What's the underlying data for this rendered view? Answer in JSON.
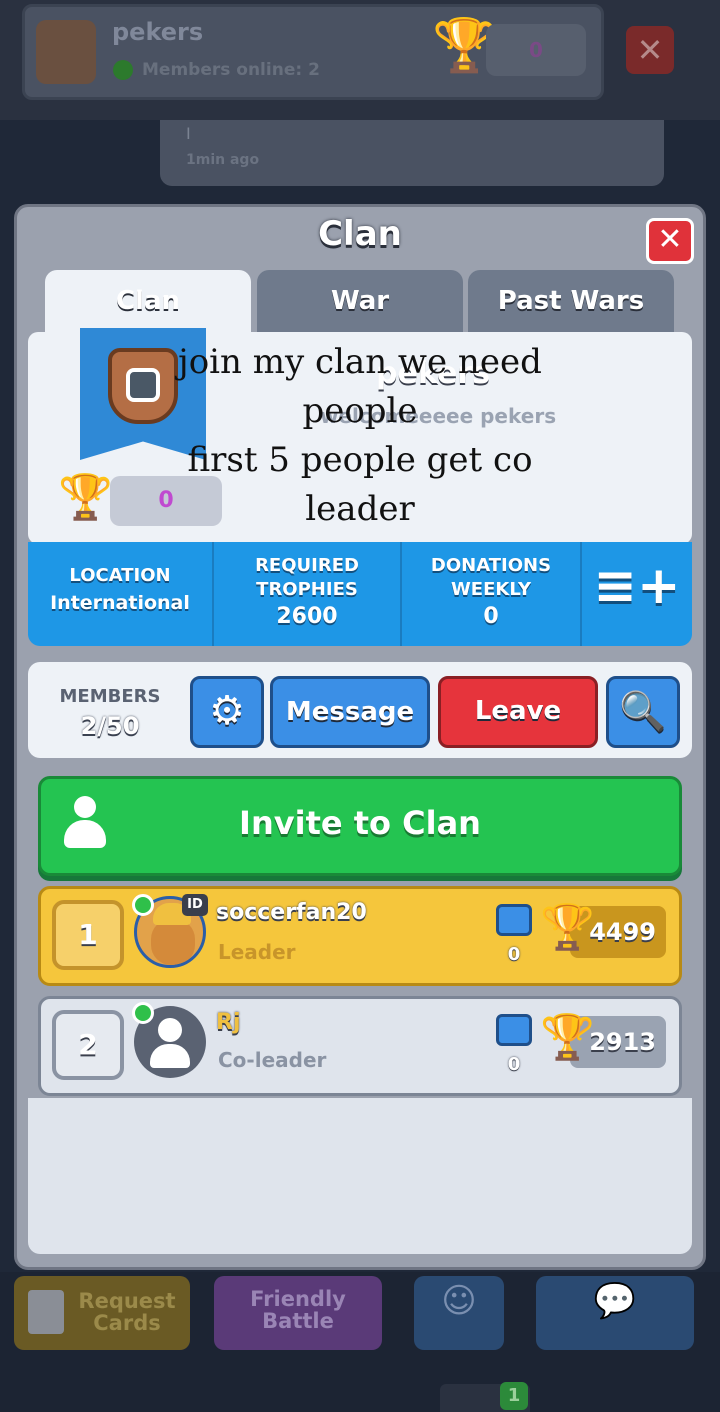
{
  "background": {
    "clan_name": "pekers",
    "members_online": "Members online: 2",
    "trophy_count": "0",
    "chat_message": "I",
    "chat_time": "1min ago"
  },
  "modal": {
    "title": "Clan",
    "close_label": "✕",
    "tabs": [
      {
        "label": "Clan",
        "active": true
      },
      {
        "label": "War",
        "active": false
      },
      {
        "label": "Past Wars",
        "active": false
      }
    ],
    "overlay_text": [
      "join my clan we need",
      "people",
      "first 5 people get co",
      "leader"
    ],
    "clan_name": "pekers",
    "clan_description": "welcomeeeee pekers",
    "clan_trophies": "0",
    "stats": {
      "location_label": "LOCATION",
      "location_value": "International",
      "required_label_1": "REQUIRED",
      "required_label_2": "TROPHIES",
      "required_value": "2600",
      "donations_label_1": "DONATIONS",
      "donations_label_2": "WEEKLY",
      "donations_value": "0",
      "menu_icon": "list-add-icon"
    },
    "members": {
      "label": "MEMBERS",
      "value": "2/50"
    },
    "buttons": {
      "settings_icon": "gear-icon",
      "message": "Message",
      "leave": "Leave",
      "search_icon": "search-icon"
    },
    "invite_label": "Invite to Clan",
    "member_list": [
      {
        "rank": "1",
        "name": "soccerfan20",
        "role": "Leader",
        "donations": "0",
        "trophies": "4499",
        "id_tag": "ID"
      },
      {
        "rank": "2",
        "name": "Rj",
        "role": "Co-leader",
        "donations": "0",
        "trophies": "2913"
      }
    ]
  },
  "bottom_bar": {
    "request_cards": [
      "Request",
      "Cards"
    ],
    "friendly_battle": [
      "Friendly",
      "Battle"
    ],
    "emote_icon": "smile-chat-icon",
    "chat_icon": "chat-bubble-icon",
    "notification_count": "1"
  },
  "colors": {
    "accent_blue": "#1e97e6",
    "invite_green": "#24c451",
    "leave_red": "#e6343c",
    "leader_gold": "#f5c63c"
  }
}
